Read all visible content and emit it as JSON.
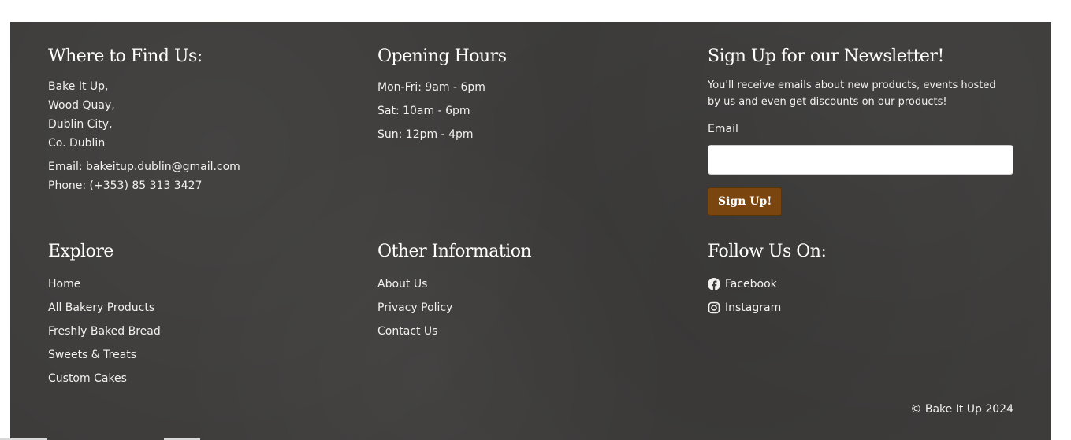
{
  "find_us": {
    "heading": "Where to Find Us:",
    "address_lines": [
      "Bake It Up,",
      "Wood Quay,",
      "Dublin City,",
      "Co. Dublin"
    ],
    "email": "Email: bakeitup.dublin@gmail.com",
    "phone": "Phone: (+353) 85 313 3427"
  },
  "hours": {
    "heading": "Opening Hours",
    "lines": [
      "Mon-Fri: 9am - 6pm",
      "Sat: 10am - 6pm",
      "Sun: 12pm - 4pm"
    ]
  },
  "newsletter": {
    "heading": "Sign Up for our Newsletter!",
    "description": "You'll receive emails about new products, events hosted by us and even get discounts on our products!",
    "email_label": "Email",
    "email_value": "",
    "button_label": "Sign Up!",
    "button_color": "#7b4510"
  },
  "explore": {
    "heading": "Explore",
    "links": [
      "Home",
      "All Bakery Products",
      "Freshly Baked Bread",
      "Sweets & Treats",
      "Custom Cakes"
    ]
  },
  "other_info": {
    "heading": "Other Information",
    "links": [
      "About Us",
      "Privacy Policy",
      "Contact Us"
    ]
  },
  "follow": {
    "heading": "Follow Us On:",
    "items": [
      {
        "label": "Facebook",
        "icon": "facebook-icon"
      },
      {
        "label": "Instagram",
        "icon": "instagram-icon"
      }
    ]
  },
  "copyright": "© Bake It Up 2024",
  "colors": {
    "footer_bg": "#3d3c3b",
    "text": "#f3f1ee"
  }
}
